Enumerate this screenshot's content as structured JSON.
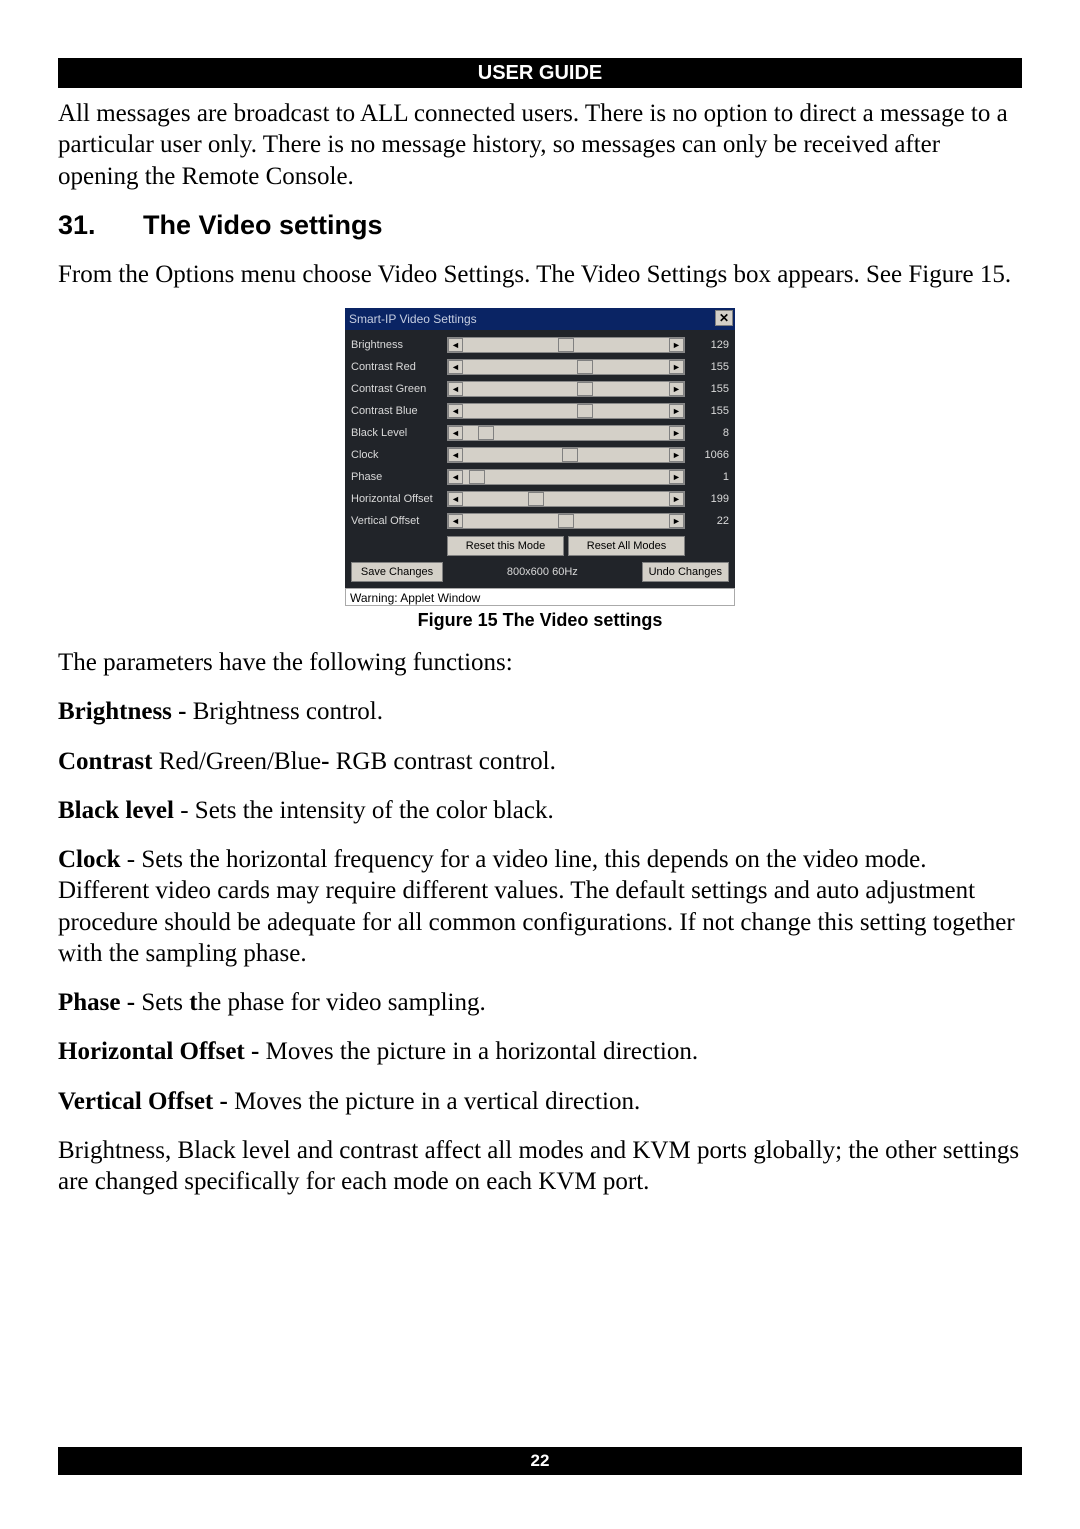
{
  "header": {
    "title": "USER GUIDE"
  },
  "intro_para": "All messages are broadcast to ALL connected users. There is no option to direct a message to a particular user only. There is no message history, so messages can only be received after opening the Remote Console.",
  "section": {
    "number": "31.",
    "title": "The Video settings"
  },
  "section_intro": "From the Options menu choose Video Settings. The Video Settings box appears. See Figure 15.",
  "video_settings": {
    "window_title": "Smart-IP Video Settings",
    "close_glyph": "✕",
    "rows": [
      {
        "label": "Brightness",
        "value": "129",
        "thumb_pct": 50
      },
      {
        "label": "Contrast Red",
        "value": "155",
        "thumb_pct": 60
      },
      {
        "label": "Contrast Green",
        "value": "155",
        "thumb_pct": 60
      },
      {
        "label": "Contrast Blue",
        "value": "155",
        "thumb_pct": 60
      },
      {
        "label": "Black Level",
        "value": "8",
        "thumb_pct": 8
      },
      {
        "label": "Clock",
        "value": "1066",
        "thumb_pct": 52
      },
      {
        "label": "Phase",
        "value": "1",
        "thumb_pct": 3
      },
      {
        "label": "Horizontal Offset",
        "value": "199",
        "thumb_pct": 34
      },
      {
        "label": "Vertical Offset",
        "value": "22",
        "thumb_pct": 50
      }
    ],
    "buttons": {
      "reset_this": "Reset this Mode",
      "reset_all": "Reset All Modes",
      "save": "Save Changes",
      "undo": "Undo Changes"
    },
    "resolution": "800x600 60Hz",
    "status": "Warning: Applet Window"
  },
  "figure_caption": "Figure 15 The Video settings",
  "params_intro": "The parameters have the following functions:",
  "params": {
    "brightness_label": "Brightness - ",
    "brightness_text": "Brightness control.",
    "contrast_label": "Contrast",
    "contrast_mid": " Red/Green/Blue",
    "contrast_dash": "- ",
    "contrast_text": "RGB contrast control.",
    "blacklevel_label": "Black level",
    "blacklevel_text": " - Sets the intensity of the color black.",
    "clock_label": "Clock",
    "clock_text": " - Sets the horizontal frequency for a video line, this depends on the video mode. Different video cards may require different values. The default settings and auto adjustment procedure should be adequate for all common configurations. If not change this setting together with the sampling phase.",
    "phase_label": "Phase - ",
    "phase_text1": "Sets ",
    "phase_t": "t",
    "phase_text2": "he phase for video sampling.",
    "hoff_label": "Horizontal Offset - ",
    "hoff_text": "Moves the picture in a horizontal direction.",
    "voff_label": "Vertical Offset - ",
    "voff_text": "Moves the picture in a vertical direction.",
    "closing": "Brightness, Black level and contrast affect all modes and KVM ports globally; the other settings are changed specifically for each mode on each KVM port."
  },
  "footer": {
    "page": "22"
  },
  "arrow_left": "◄",
  "arrow_right": "►"
}
